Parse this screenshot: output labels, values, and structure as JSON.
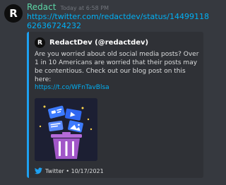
{
  "message": {
    "avatar_letter": "R",
    "username": "Redact",
    "timestamp": "Today at 6:58 PM",
    "link": "https://twitter.com/redactdev/status/1449911862636724232"
  },
  "embed": {
    "author_avatar_letter": "R",
    "author_name": "RedactDev (@redactdev)",
    "description": "Are you worried about old social media posts? Over 1 in 10 Americans are worried that their posts may be contentious. Check out our blog post on this here:",
    "link": "https://t.co/WFnTavBlsa",
    "footer_text": "Twitter • 10/17/2021",
    "footer_icon": "twitter-icon",
    "accent_color": "#1da1f2"
  }
}
